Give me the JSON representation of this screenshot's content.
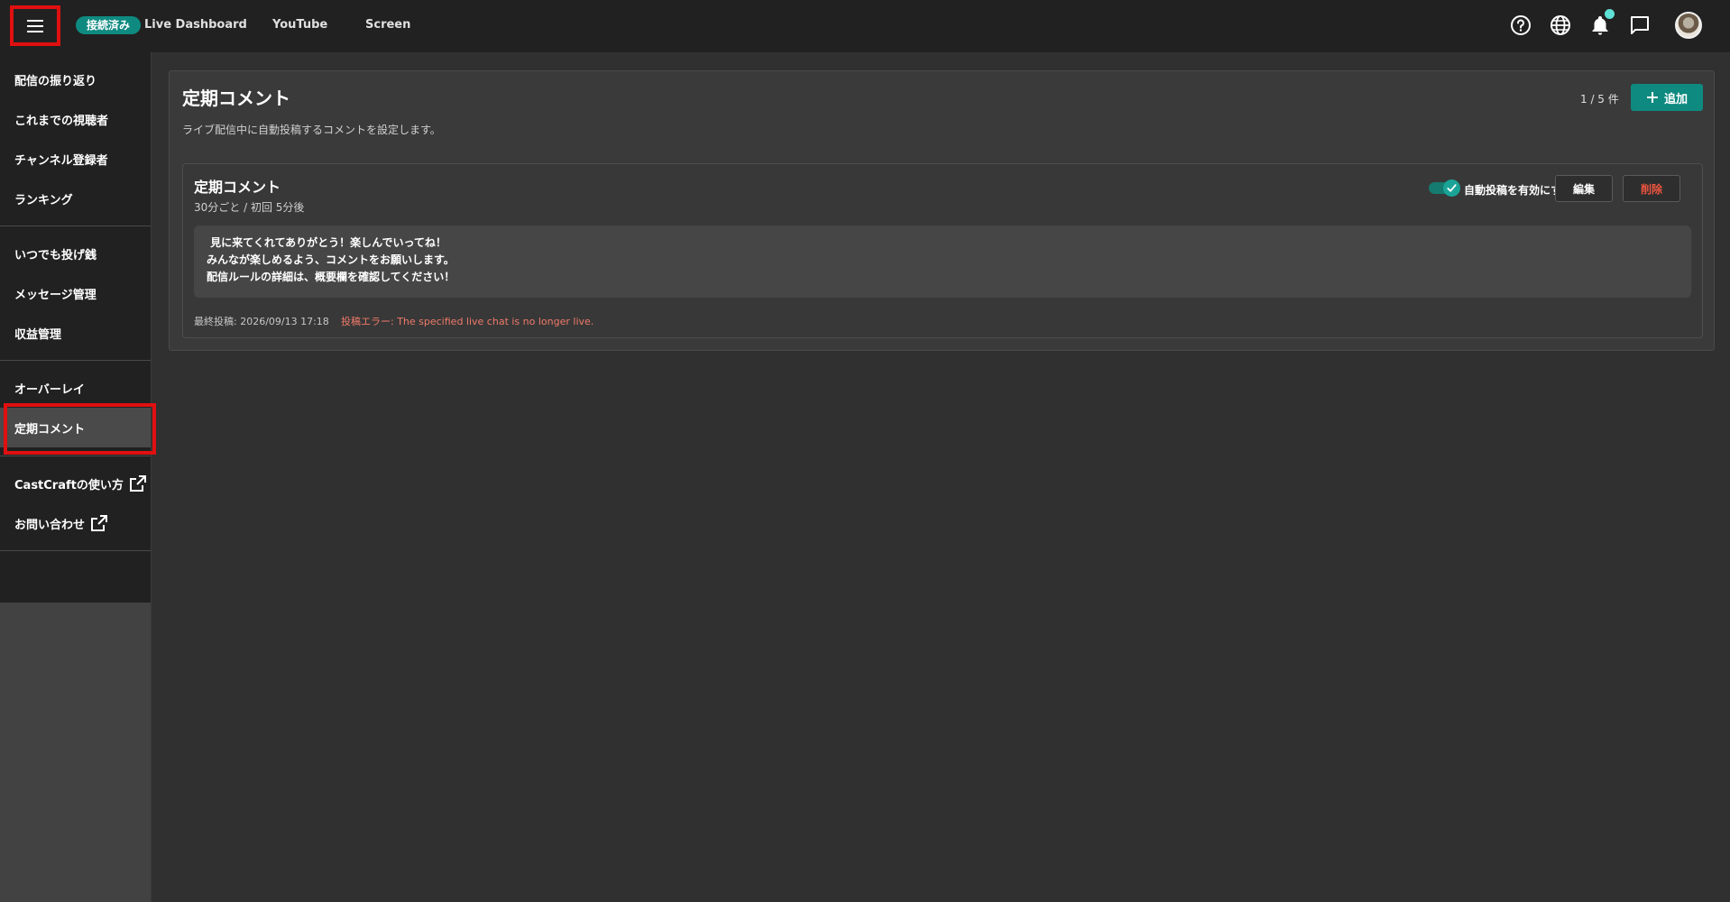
{
  "header": {
    "status_badge": "接続済み",
    "nav": [
      "Live Dashboard",
      "YouTube",
      "Screen"
    ],
    "icons": [
      "help-icon",
      "globe-icon",
      "bell-icon",
      "chat-icon"
    ],
    "accent_color": "#0e8a80"
  },
  "sidebar": {
    "group1": [
      "配信の振り返り",
      "これまでの視聴者",
      "チャンネル登録者",
      "ランキング"
    ],
    "group2": [
      "いつでも投げ銭",
      "メッセージ管理",
      "収益管理"
    ],
    "group3": [
      "オーバーレイ",
      "定期コメント"
    ],
    "group4": [
      "CastCraftの使い方",
      "お問い合わせ"
    ],
    "active": "定期コメント"
  },
  "main": {
    "title": "定期コメント",
    "description": "ライブ配信中に自動投稿するコメントを設定します。",
    "count": "1 / 5 件",
    "add_label": "追加",
    "card": {
      "title": "定期コメント",
      "schedule": "30分ごと / 初回 5分後",
      "toggle_label": "自動投稿を有効にする",
      "toggle_on": true,
      "edit_label": "編集",
      "delete_label": "削除",
      "comment_lines": [
        " 見に来てくれてありがとう！楽しんでいってね！",
        "みんなが楽しめるよう、コメントをお願いします。",
        "配信ルールの詳細は、概要欄を確認してください！"
      ],
      "last_post": "最終投稿: 2026/09/13 17:18",
      "error": "投稿エラー: The specified live chat is no longer live."
    }
  }
}
